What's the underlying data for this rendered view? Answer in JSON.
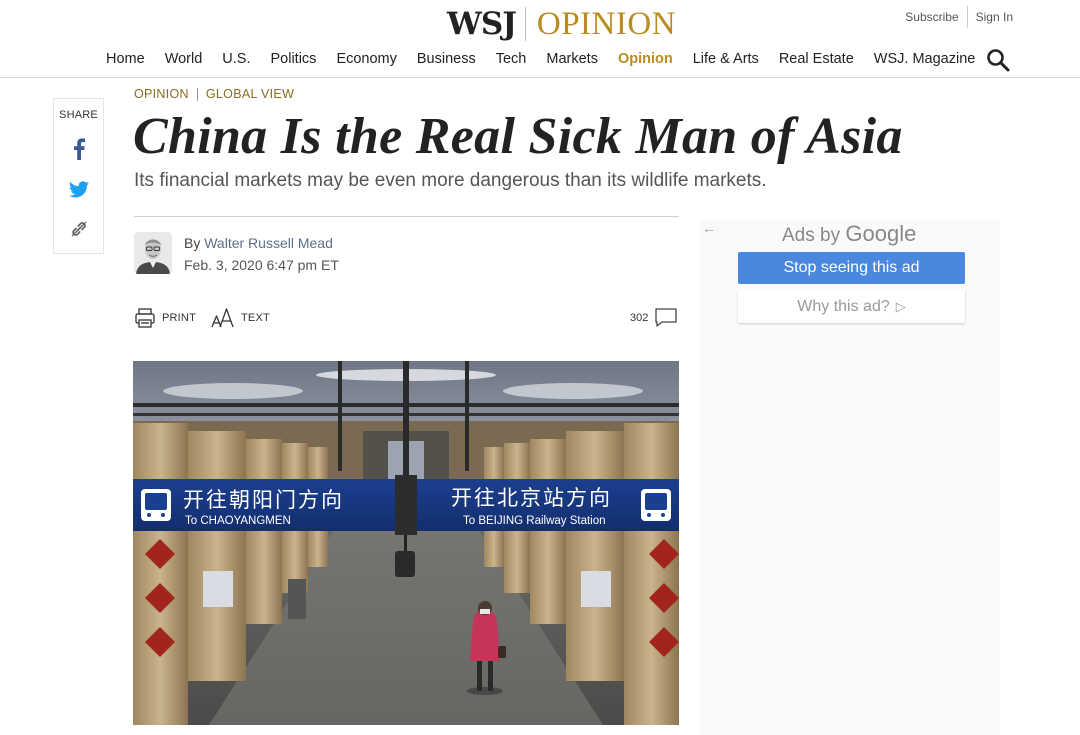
{
  "brand": {
    "logo_wsj": "WSJ",
    "logo_section": "OPINION",
    "accent": "#b98c22"
  },
  "account": {
    "subscribe": "Subscribe",
    "sign_in": "Sign In"
  },
  "nav": {
    "items": [
      {
        "label": "Home"
      },
      {
        "label": "World"
      },
      {
        "label": "U.S."
      },
      {
        "label": "Politics"
      },
      {
        "label": "Economy"
      },
      {
        "label": "Business"
      },
      {
        "label": "Tech"
      },
      {
        "label": "Markets"
      },
      {
        "label": "Opinion",
        "active": true
      },
      {
        "label": "Life & Arts"
      },
      {
        "label": "Real Estate"
      },
      {
        "label": "WSJ. Magazine"
      }
    ],
    "search_icon": "search-icon"
  },
  "share": {
    "label": "SHARE",
    "icons": [
      "facebook-icon",
      "twitter-icon",
      "link-icon"
    ],
    "colors": {
      "facebook": "#3b5998",
      "twitter": "#1da1f2",
      "link": "#666666"
    }
  },
  "article": {
    "flashline_section": "OPINION",
    "flashline_column": "GLOBAL VIEW",
    "headline": "China Is the Real Sick Man of Asia",
    "dek": "Its financial markets may be even more dangerous than its wildlife markets.",
    "byline_prefix": "By",
    "author": "Walter Russell Mead",
    "timestamp": "Feb. 3, 2020 6:47 pm ET",
    "tools": {
      "print": "PRINT",
      "text": "TEXT"
    },
    "comment_count": "302",
    "photo": {
      "sign_left_cn": "开往朝阳门方向",
      "sign_left_en": "To CHAOYANGMEN",
      "sign_right_cn": "开往北京站方向",
      "sign_right_en": "To BEIJING Railway Station"
    }
  },
  "ads": {
    "back_arrow": "←",
    "ads_by": "Ads by",
    "google": "Google",
    "stop_label": "Stop seeing this ad",
    "why_label": "Why this ad?",
    "why_icon": "▷"
  }
}
